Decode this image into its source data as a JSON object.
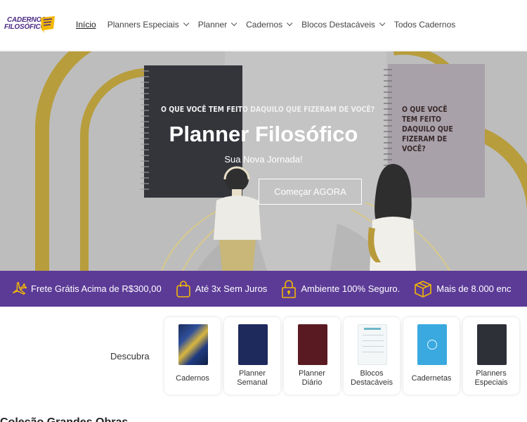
{
  "logo": {
    "line1": "CADERNOS",
    "line2": "FILOSÓFICOS"
  },
  "nav": [
    {
      "label": "Início",
      "active": true,
      "dropdown": false
    },
    {
      "label": "Planners Especiais",
      "active": false,
      "dropdown": true
    },
    {
      "label": "Planner",
      "active": false,
      "dropdown": true
    },
    {
      "label": "Cadernos",
      "active": false,
      "dropdown": true
    },
    {
      "label": "Blocos Destacáveis",
      "active": false,
      "dropdown": true
    },
    {
      "label": "Todos Cadernos",
      "active": false,
      "dropdown": false
    }
  ],
  "hero": {
    "title": "Planner Filosófico",
    "subtitle": "Sua Nova Jornada!",
    "cta": "Começar AGORA",
    "notebook_text": "O QUE VOCÊ TEM FEITO DAQUILO QUE FIZERAM DE VOCÊ?"
  },
  "benefits": [
    {
      "icon": "airplane-icon",
      "text": "Frete Grátis Acima de R$300,00"
    },
    {
      "icon": "shopping-bag-icon",
      "text": "Até 3x Sem Juros"
    },
    {
      "icon": "padlock-icon",
      "text": "Ambiente 100% Seguro."
    },
    {
      "icon": "box-icon",
      "text": "Mais de 8.000 enc"
    }
  ],
  "discover": {
    "label": "Descubra",
    "categories": [
      {
        "line1": "Cadernos",
        "line2": ""
      },
      {
        "line1": "Planner",
        "line2": "Semanal"
      },
      {
        "line1": "Planner",
        "line2": "Diário"
      },
      {
        "line1": "Blocos",
        "line2": "Destacáveis"
      },
      {
        "line1": "Cadernetas",
        "line2": ""
      },
      {
        "line1": "Planners",
        "line2": "Especiais"
      }
    ]
  },
  "section_heading_cut": "Coleção Grandes Obras",
  "colors": {
    "brand_purple": "#5c3b97",
    "accent_gold": "#f2b705",
    "logo_purple": "#4b2a86"
  }
}
